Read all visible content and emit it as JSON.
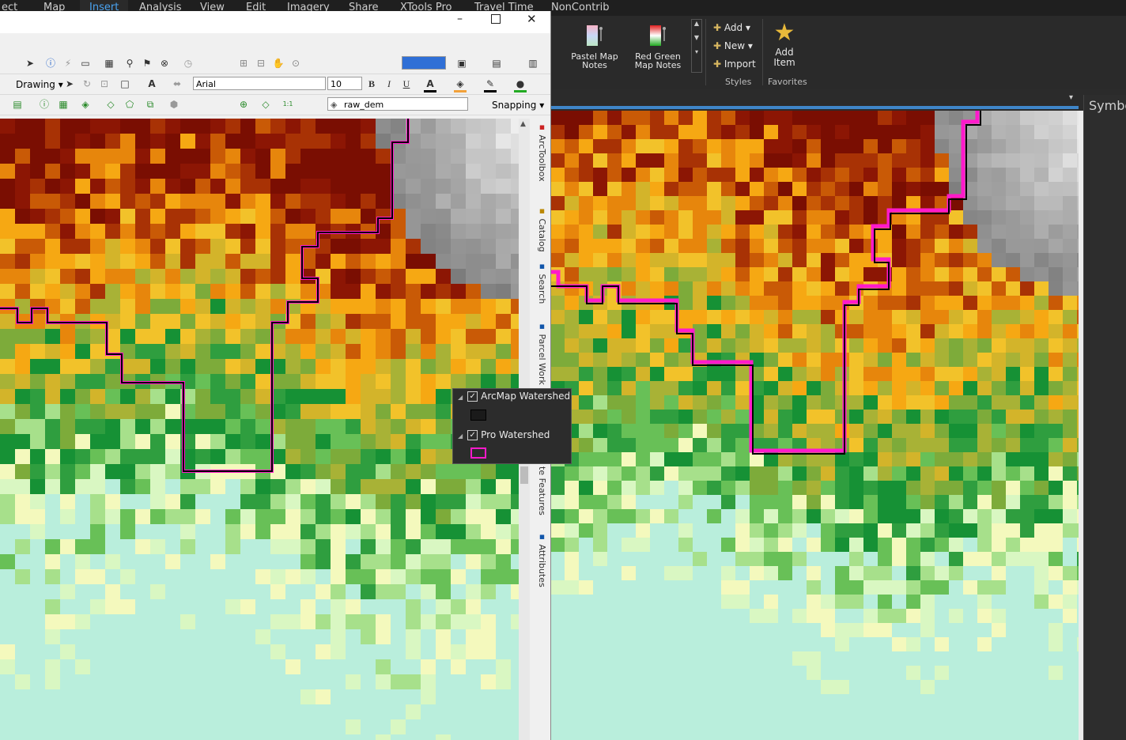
{
  "pro": {
    "tabs": [
      "ect",
      "Map",
      "Insert",
      "Analysis",
      "View",
      "Edit",
      "Imagery",
      "Share",
      "XTools Pro",
      "Travel Time",
      "NonContrib"
    ],
    "active_tab": "Insert",
    "ribbon": {
      "pastel_label": "Pastel Map Notes",
      "redgreen_label": "Red Green Map Notes",
      "add_label": "Add",
      "new_label": "New",
      "import_label": "Import",
      "styles_group": "Styles",
      "add_item_label": "Add Item",
      "favorites_group": "Favorites"
    },
    "right_pane_title": "Symbo"
  },
  "arcmap": {
    "toolbar_draw": {
      "drawing_label": "Drawing",
      "font_name": "Arial",
      "font_size": "10",
      "bold": "B",
      "italic": "I",
      "underline": "U"
    },
    "toolbar_raster": {
      "layer_select": "raw_dem",
      "snapping_label": "Snapping"
    },
    "dock_tabs": [
      "ArcToolbox",
      "Catalog",
      "Search",
      "Parcel Work",
      "te Features",
      "Attributes"
    ]
  },
  "legend": {
    "items": [
      {
        "label": "ArcMap Watershed",
        "checked": true,
        "color": "#000000"
      },
      {
        "label": "Pro Watershed",
        "checked": true,
        "color": "#ff1acb"
      }
    ]
  },
  "colors": {
    "accent": "#4aa3f0",
    "pro_boundary": "#ff1acb",
    "arcmap_boundary": "#000000"
  }
}
